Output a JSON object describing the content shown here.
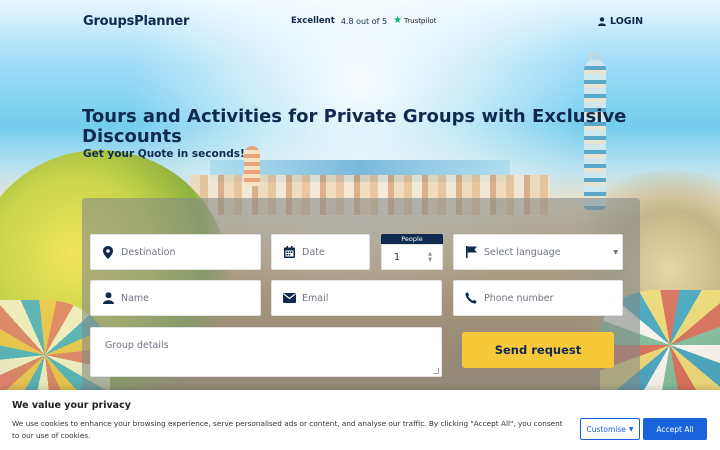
{
  "header": {
    "logo": "GroupsPlanner",
    "rating_label": "Excellent",
    "rating_score": "4.8 out of 5",
    "rating_source": "Trustpilot",
    "login_label": "LOGIN"
  },
  "hero": {
    "headline": "Tours and Activities for Private Groups with Exclusive Discounts",
    "subheadline": "Get your Quote in seconds!"
  },
  "form": {
    "destination_placeholder": "Destination",
    "date_placeholder": "Date",
    "people_label": "People",
    "people_value": "1",
    "language_placeholder": "Select language",
    "name_placeholder": "Name",
    "email_placeholder": "Email",
    "phone_placeholder": "Phone number",
    "details_placeholder": "Group details",
    "submit_label": "Send request"
  },
  "cookie": {
    "title": "We value your privacy",
    "text": "We use cookies to enhance your browsing experience, serve personalised ads or content, and analyse our traffic. By clicking \"Accept All\", you consent to our use of cookies.",
    "customise_label": "Customise",
    "accept_label": "Accept All"
  },
  "colors": {
    "brand_navy": "#0f2a4e",
    "cta_yellow": "#f7c83a",
    "accept_blue": "#1863dc",
    "trustpilot_green": "#00b67a"
  },
  "icons": [
    "map-pin-icon",
    "calendar-icon",
    "flag-icon",
    "user-icon",
    "envelope-icon",
    "phone-icon",
    "star-icon"
  ]
}
